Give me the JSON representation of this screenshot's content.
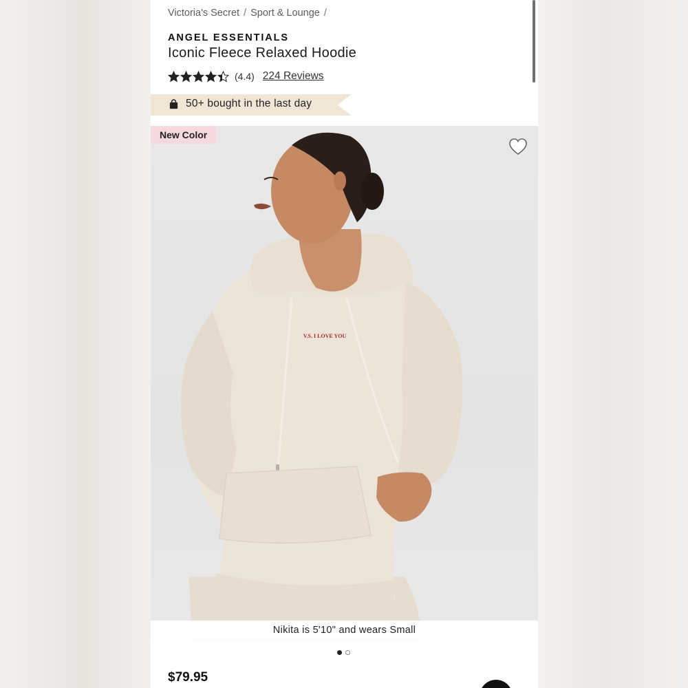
{
  "breadcrumb": {
    "items": [
      "Victoria's Secret",
      "Sport & Lounge"
    ],
    "separator": "/"
  },
  "product": {
    "brand": "ANGEL ESSENTIALS",
    "title": "Iconic Fleece Relaxed Hoodie",
    "rating": 4.4,
    "rating_text": "(4.4)",
    "reviews_text": "224 Reviews",
    "price": "$79.95"
  },
  "bought_banner": {
    "icon": "shopping-bag-icon",
    "text": "50+ bought in the last day"
  },
  "gallery": {
    "badge": "New Color",
    "caption": "Nikita is 5'10\" and wears Small",
    "print_text": "V.S. I LOVE YOU",
    "favorite_icon": "heart-outline-icon",
    "slide_count": 2,
    "active_slide": 1
  },
  "colors": {
    "banner_bg": "#f1e6d6",
    "badge_bg": "#f6d9de",
    "text_primary": "#111111",
    "hoodie": "#ece4d7",
    "print_red": "#a52a2a"
  }
}
